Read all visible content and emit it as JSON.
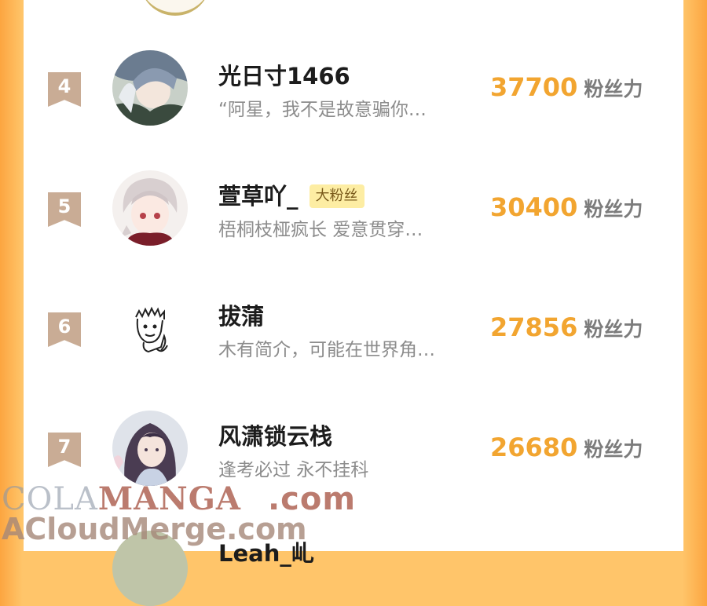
{
  "leaderboard": {
    "rows": [
      {
        "rank": "4",
        "name": "光日寸1466",
        "tag": "",
        "bio": "“阿星，我不是故意骗你…",
        "score": "37700",
        "unit": "粉丝力",
        "avatar": "avatar-image"
      },
      {
        "rank": "5",
        "name": "萱草吖_",
        "tag": "大粉丝",
        "bio": "梧桐枝桠疯长 爱意贯穿…",
        "score": "30400",
        "unit": "粉丝力",
        "avatar": "avatar-image"
      },
      {
        "rank": "6",
        "name": "拔蒲",
        "tag": "",
        "bio": "木有简介，可能在世界角…",
        "score": "27856",
        "unit": "粉丝力",
        "avatar": "sketch-avatar-image"
      },
      {
        "rank": "7",
        "name": "风潇锁云栈",
        "tag": "",
        "bio": "逢考必过 永不挂科",
        "score": "26680",
        "unit": "粉丝力",
        "avatar": "avatar-image"
      }
    ],
    "next_partial_name": "Leah_乢"
  },
  "watermark": {
    "line1_light": "COLA",
    "line1_dark": "MANGA",
    "line1_suffix": ".com",
    "line2": "ACloudMerge.com"
  },
  "colors": {
    "accent_orange": "#f2a530",
    "badge": "#c9ac95",
    "tag_bg": "#fdeda3",
    "side_bg": "#ffc56a"
  }
}
